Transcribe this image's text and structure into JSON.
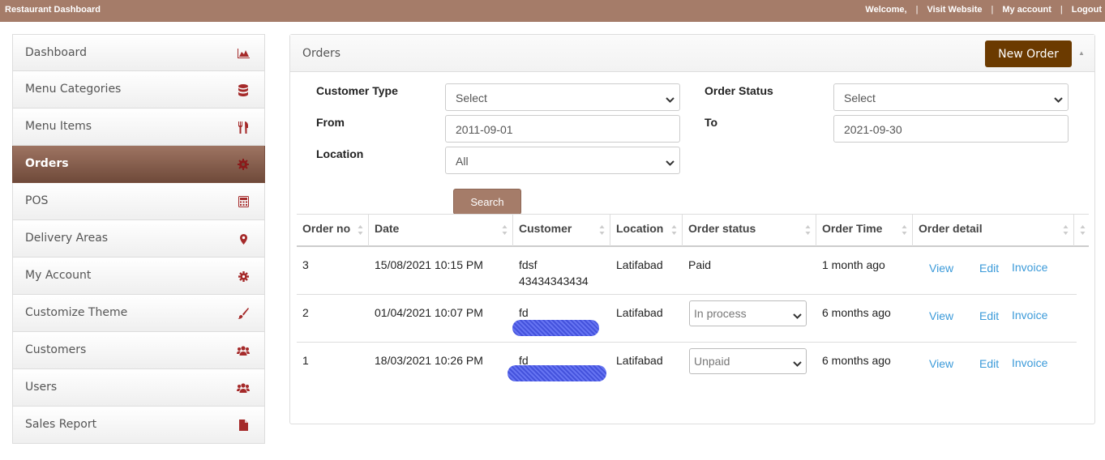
{
  "topbar": {
    "brand": "Restaurant Dashboard",
    "links": [
      "Welcome,",
      "Visit Website",
      "My account",
      "Logout"
    ]
  },
  "sidebar": {
    "items": [
      {
        "label": "Dashboard",
        "icon": "area-chart-icon"
      },
      {
        "label": "Menu Categories",
        "icon": "database-icon"
      },
      {
        "label": "Menu Items",
        "icon": "cutlery-icon"
      },
      {
        "label": "Orders",
        "icon": "gear-flower-icon",
        "active": true
      },
      {
        "label": "POS",
        "icon": "calculator-icon"
      },
      {
        "label": "Delivery Areas",
        "icon": "map-marker-icon"
      },
      {
        "label": "My Account",
        "icon": "cog-icon"
      },
      {
        "label": "Customize Theme",
        "icon": "paint-brush-icon"
      },
      {
        "label": "Customers",
        "icon": "users-icon"
      },
      {
        "label": "Users",
        "icon": "users-icon"
      },
      {
        "label": "Sales Report",
        "icon": "file-icon"
      }
    ]
  },
  "panel": {
    "title": "Orders",
    "new_order_label": "New Order"
  },
  "filters": {
    "customer_type_label": "Customer Type",
    "customer_type_value": "Select",
    "order_status_label": "Order Status",
    "order_status_value": "Select",
    "from_label": "From",
    "from_value": "2011-09-01",
    "to_label": "To",
    "to_value": "2021-09-30",
    "location_label": "Location",
    "location_value": "All",
    "search_label": "Search"
  },
  "table": {
    "headers": [
      "Order no",
      "Date",
      "Customer",
      "Location",
      "Order status",
      "Order Time",
      "Order detail"
    ],
    "rows": [
      {
        "order_no": "3",
        "date": "15/08/2021 10:15 PM",
        "customer": "fdsf",
        "customer_phone": "43434343434",
        "location": "Latifabad",
        "status": "Paid",
        "time": "1 month ago"
      },
      {
        "order_no": "2",
        "date": "01/04/2021 10:07 PM",
        "customer": "fd",
        "customer_phone": "",
        "location": "Latifabad",
        "status": "In process",
        "time": "6 months ago"
      },
      {
        "order_no": "1",
        "date": "18/03/2021 10:26 PM",
        "customer": "fd",
        "customer_phone": "",
        "location": "Latifabad",
        "status": "Unpaid",
        "time": "6 months ago"
      }
    ],
    "actions": {
      "view": "View",
      "edit": "Edit",
      "invoice": "Invoice"
    }
  },
  "colors": {
    "topbar": "#a57c69",
    "accent_brown": "#6b3a00",
    "link": "#3b9ad9",
    "icon_red": "#a52a2a"
  }
}
